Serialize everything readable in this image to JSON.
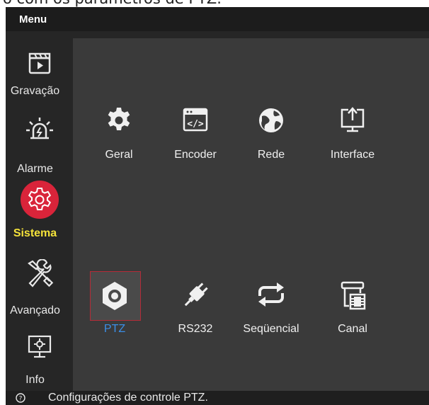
{
  "caption": "o com os parâmetros de PTZ.",
  "menubar": {
    "title": "Menu"
  },
  "sidebar": {
    "items": [
      {
        "label": "Gravação",
        "icon": "recording-clapper-icon"
      },
      {
        "label": "Alarme",
        "icon": "alarm-siren-icon"
      },
      {
        "label": "Sistema",
        "icon": "gear-icon",
        "active": true
      },
      {
        "label": "Avançado",
        "icon": "tools-icon"
      },
      {
        "label": "Info",
        "icon": "monitor-info-icon"
      }
    ]
  },
  "tiles": [
    {
      "label": "Geral",
      "icon": "gear-icon"
    },
    {
      "label": "Encoder",
      "icon": "code-window-icon"
    },
    {
      "label": "Rede",
      "icon": "globe-icon"
    },
    {
      "label": "Interface",
      "icon": "monitor-upload-icon"
    },
    {
      "label": "PTZ",
      "icon": "hexagon-camera-icon",
      "selected": true
    },
    {
      "label": "RS232",
      "icon": "plug-icon"
    },
    {
      "label": "Seqüencial",
      "icon": "loop-arrows-icon"
    },
    {
      "label": "Canal",
      "icon": "channel-camera-icon"
    }
  ],
  "status": {
    "text": "Configurações de controle PTZ.",
    "icon": "help-circle-icon"
  },
  "colors": {
    "accent_active": "#d9243a",
    "label_active": "#f4e23a",
    "label_selected": "#3a8ee6"
  }
}
